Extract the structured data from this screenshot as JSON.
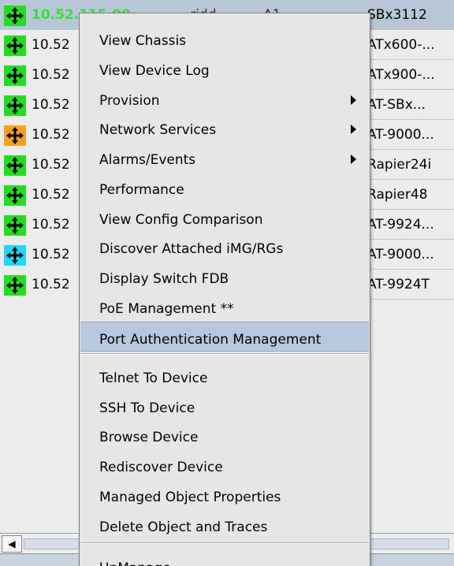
{
  "table": {
    "rows": [
      {
        "icon": "green",
        "ip": "10.52.115.00",
        "col2": "...ridd... ... ...A1",
        "model": "SBx3112",
        "selected": true
      },
      {
        "icon": "green",
        "ip": "10.52",
        "model": "ATx600-..."
      },
      {
        "icon": "green",
        "ip": "10.52",
        "model": "ATx900-..."
      },
      {
        "icon": "green",
        "ip": "10.52",
        "model": "AT-SBx..."
      },
      {
        "icon": "orange",
        "ip": "10.52",
        "model": "AT-9000..."
      },
      {
        "icon": "green",
        "ip": "10.52",
        "model": "Rapier24i"
      },
      {
        "icon": "green",
        "ip": "10.52",
        "model": "Rapier48"
      },
      {
        "icon": "green",
        "ip": "10.52",
        "model": "AT-9924..."
      },
      {
        "icon": "cyan",
        "ip": "10.52",
        "model": "AT-9000..."
      },
      {
        "icon": "green",
        "ip": "10.52",
        "model": "AT-9924T"
      }
    ],
    "icon_colors": {
      "green": "#22dd22",
      "orange": "#f5a020",
      "cyan": "#20d8ff"
    }
  },
  "scrollbar": {
    "left_arrow": "◀"
  },
  "context_menu": {
    "items": [
      {
        "label": "View Chassis"
      },
      {
        "label": "View Device Log"
      },
      {
        "label": "Provision",
        "submenu": true
      },
      {
        "label": "Network Services",
        "submenu": true
      },
      {
        "label": "Alarms/Events",
        "submenu": true
      },
      {
        "label": "Performance"
      },
      {
        "label": "View Config Comparison"
      },
      {
        "label": "Discover Attached iMG/RGs"
      },
      {
        "label": "Display Switch FDB"
      },
      {
        "label": "PoE Management **"
      },
      {
        "label": "Port Authentication Management",
        "highlighted": true
      },
      {
        "label": "Telnet To Device"
      },
      {
        "label": "SSH To Device"
      },
      {
        "label": "Browse Device"
      },
      {
        "label": "Rediscover Device"
      },
      {
        "label": "Managed Object Properties"
      },
      {
        "label": "Delete Object and Traces"
      },
      {
        "label": "UnManage"
      }
    ],
    "highlight_color": "#b8c8dc"
  }
}
